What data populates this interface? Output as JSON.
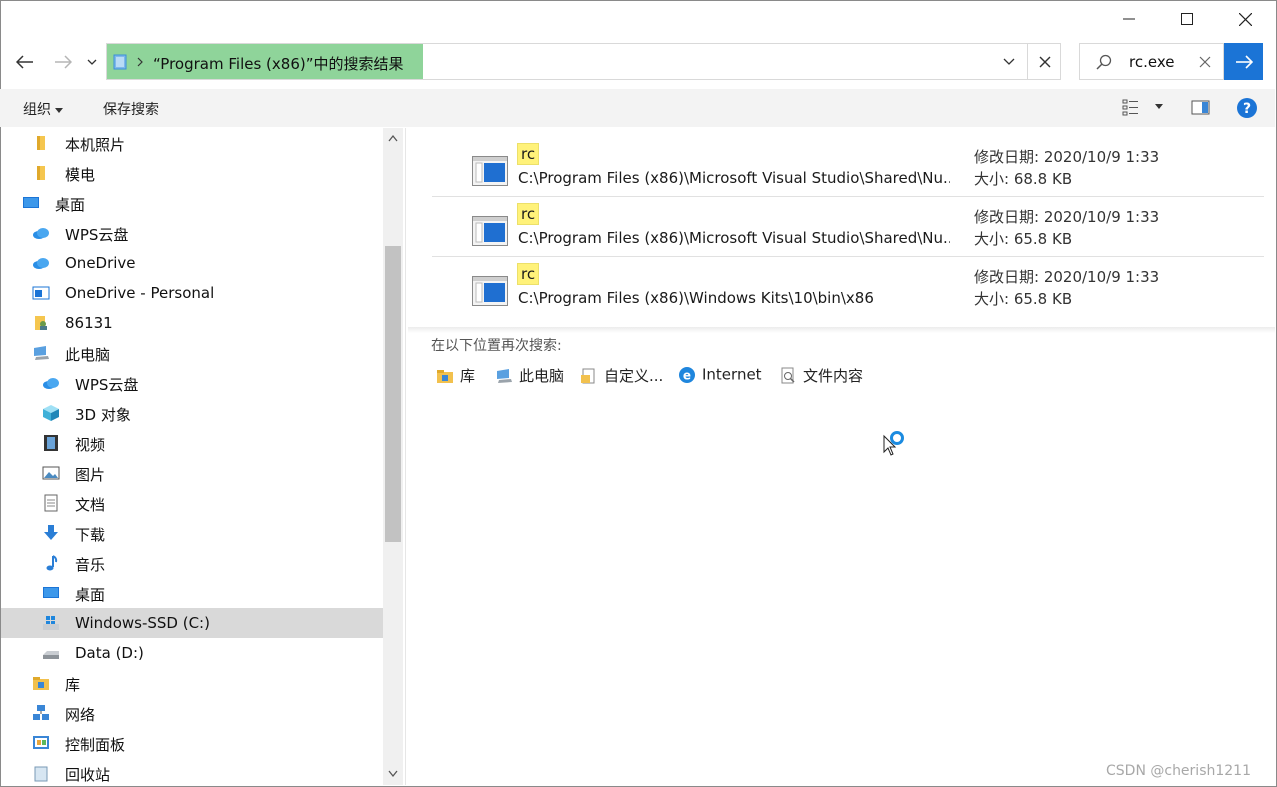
{
  "titlebar": {
    "minimize": "minimize",
    "maximize": "maximize",
    "close": "close"
  },
  "address": {
    "text": "“Program Files (x86)”中的搜索结果"
  },
  "search": {
    "value": "rc.exe"
  },
  "toolbar": {
    "organize": "组织",
    "save_search": "保存搜索"
  },
  "nav": [
    {
      "label": "本机照片",
      "icon": "folder-icon"
    },
    {
      "label": "模电",
      "icon": "folder-icon"
    },
    {
      "label": "桌面",
      "icon": "desktop-icon"
    },
    {
      "label": "WPS云盘",
      "icon": "cloud-icon"
    },
    {
      "label": "OneDrive",
      "icon": "cloud-icon"
    },
    {
      "label": "OneDrive - Personal",
      "icon": "window-icon"
    },
    {
      "label": "86131",
      "icon": "user-folder-icon"
    },
    {
      "label": "此电脑",
      "icon": "computer-icon"
    },
    {
      "label": "WPS云盘",
      "icon": "cloud-icon"
    },
    {
      "label": "3D 对象",
      "icon": "cube-icon"
    },
    {
      "label": "视频",
      "icon": "video-icon"
    },
    {
      "label": "图片",
      "icon": "picture-icon"
    },
    {
      "label": "文档",
      "icon": "document-icon"
    },
    {
      "label": "下载",
      "icon": "download-icon"
    },
    {
      "label": "音乐",
      "icon": "music-icon"
    },
    {
      "label": "桌面",
      "icon": "desktop-icon"
    },
    {
      "label": "Windows-SSD (C:)",
      "icon": "drive-c-icon"
    },
    {
      "label": "Data (D:)",
      "icon": "drive-icon"
    },
    {
      "label": "库",
      "icon": "library-icon"
    },
    {
      "label": "网络",
      "icon": "network-icon"
    },
    {
      "label": "控制面板",
      "icon": "control-panel-icon"
    },
    {
      "label": "回收站",
      "icon": "recycle-bin-icon"
    }
  ],
  "results": [
    {
      "name": "rc",
      "path": "C:\\Program Files (x86)\\Microsoft Visual Studio\\Shared\\Nu...",
      "date": "修改日期: 2020/10/9 1:33",
      "size": "大小: 68.8 KB"
    },
    {
      "name": "rc",
      "path": "C:\\Program Files (x86)\\Microsoft Visual Studio\\Shared\\Nu...",
      "date": "修改日期: 2020/10/9 1:33",
      "size": "大小: 65.8 KB"
    },
    {
      "name": "rc",
      "path": "C:\\Program Files (x86)\\Windows Kits\\10\\bin\\x86",
      "date": "修改日期: 2020/10/9 1:33",
      "size": "大小: 65.8 KB"
    }
  ],
  "search_again": {
    "label": "在以下位置再次搜索:",
    "locations": [
      "库",
      "此电脑",
      "自定义...",
      "Internet",
      "文件内容"
    ]
  },
  "watermark": "CSDN @cherish1211",
  "colors": {
    "accent": "#1b74d6",
    "highlight": "#8fd49a",
    "match": "#fff27a"
  }
}
